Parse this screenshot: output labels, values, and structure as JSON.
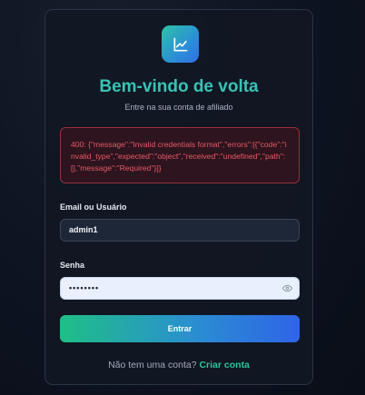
{
  "header": {
    "title": "Bem-vindo de volta",
    "subtitle": "Entre na sua conta de afiliado"
  },
  "error": {
    "message": "400: {\"message\":\"Invalid credentials format\",\"errors\":[{\"code\":\"invalid_type\",\"expected\":\"object\",\"received\":\"undefined\",\"path\":[],\"message\":\"Required\"}]}"
  },
  "form": {
    "username_label": "Email ou Usuário",
    "username_value": "admin1",
    "password_label": "Senha",
    "password_value": "••••••••",
    "submit_label": "Entrar"
  },
  "footer": {
    "prompt": "Não tem uma conta?",
    "link_label": "Criar conta"
  },
  "icons": {
    "logo": "chart-line-icon",
    "password_toggle": "eye-icon"
  },
  "colors": {
    "accent_teal": "#38c3b6",
    "accent_green": "#2fc59a",
    "button_gradient_start": "#1fbf86",
    "button_gradient_end": "#2f64e8",
    "error_text": "#e85a63"
  }
}
